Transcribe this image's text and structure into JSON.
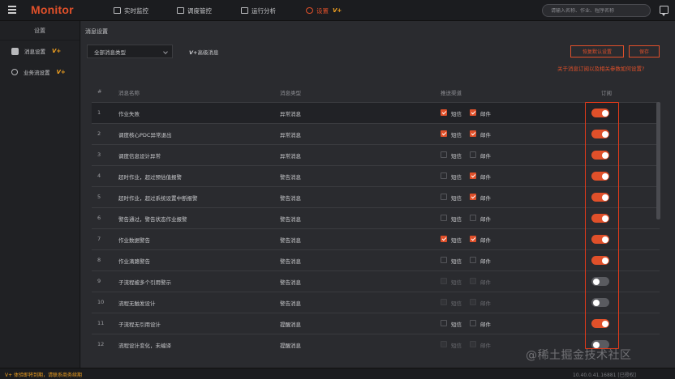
{
  "app": {
    "logo": "Monitor"
  },
  "nav": [
    {
      "label": "实时监控",
      "active": false
    },
    {
      "label": "调度管控",
      "active": false
    },
    {
      "label": "运行分析",
      "active": false
    },
    {
      "label": "设置",
      "active": true,
      "badge": "V+"
    }
  ],
  "search": {
    "placeholder": "请输入名称、作业、程序名称"
  },
  "sidebar": {
    "title": "设置",
    "items": [
      {
        "label": "消息设置",
        "badge": "V+"
      },
      {
        "label": "业务流设置",
        "badge": "V+"
      }
    ]
  },
  "main": {
    "breadcrumb": "消息设置",
    "filter_value": "全部消息类型",
    "advanced_label": "高级消息",
    "advanced_badge": "V+",
    "btn_default": "恢复默认设置",
    "btn_save": "保存",
    "help_link": "关于消息订阅以及相关参数如何设置?"
  },
  "table": {
    "headers": {
      "num": "#",
      "name": "消息名称",
      "type": "消息类型",
      "channel": "推送渠道",
      "subscribe": "订阅"
    },
    "sms_label": "短信",
    "mail_label": "邮件",
    "rows": [
      {
        "num": "1",
        "name": "作业失败",
        "type": "异常消息",
        "sms": "on",
        "mail": "on",
        "subscribed": true
      },
      {
        "num": "2",
        "name": "调度核心PDC异常退出",
        "type": "异常消息",
        "sms": "on",
        "mail": "on",
        "subscribed": true
      },
      {
        "num": "3",
        "name": "调度信息设计异常",
        "type": "异常消息",
        "sms": "off",
        "mail": "off",
        "subscribed": true
      },
      {
        "num": "4",
        "name": "超时作业，超过预估值报警",
        "type": "警告消息",
        "sms": "off",
        "mail": "on",
        "subscribed": true
      },
      {
        "num": "5",
        "name": "超时作业，超过系统设置中断报警",
        "type": "警告消息",
        "sms": "off",
        "mail": "on",
        "subscribed": true
      },
      {
        "num": "6",
        "name": "警告通过，警告状态作业报警",
        "type": "警告消息",
        "sms": "off",
        "mail": "off",
        "subscribed": true
      },
      {
        "num": "7",
        "name": "作业数据警告",
        "type": "警告消息",
        "sms": "on",
        "mail": "on",
        "subscribed": true
      },
      {
        "num": "8",
        "name": "作业滴路警告",
        "type": "警告消息",
        "sms": "off",
        "mail": "off",
        "subscribed": true
      },
      {
        "num": "9",
        "name": "子流程被多个引用警示",
        "type": "警告消息",
        "sms": "disabled",
        "mail": "disabled",
        "subscribed": false
      },
      {
        "num": "10",
        "name": "流程无触发设计",
        "type": "警告消息",
        "sms": "disabled",
        "mail": "disabled",
        "subscribed": false
      },
      {
        "num": "11",
        "name": "子流程无引用设计",
        "type": "提醒消息",
        "sms": "off",
        "mail": "off",
        "subscribed": true
      },
      {
        "num": "12",
        "name": "流程设计变化，未编译",
        "type": "提醒消息",
        "sms": "disabled",
        "mail": "disabled",
        "subscribed": false
      }
    ]
  },
  "footer": {
    "warning": "V+ 体验即将到期，请联系商务续期",
    "version": "10.40.0.41.16881 [已授权]"
  },
  "watermark": "@稀土掘金技术社区",
  "colors": {
    "accent": "#e0502a",
    "vplus": "#f0a020",
    "bg": "#2a2b2f",
    "toggle_off": "#5a5b60"
  }
}
